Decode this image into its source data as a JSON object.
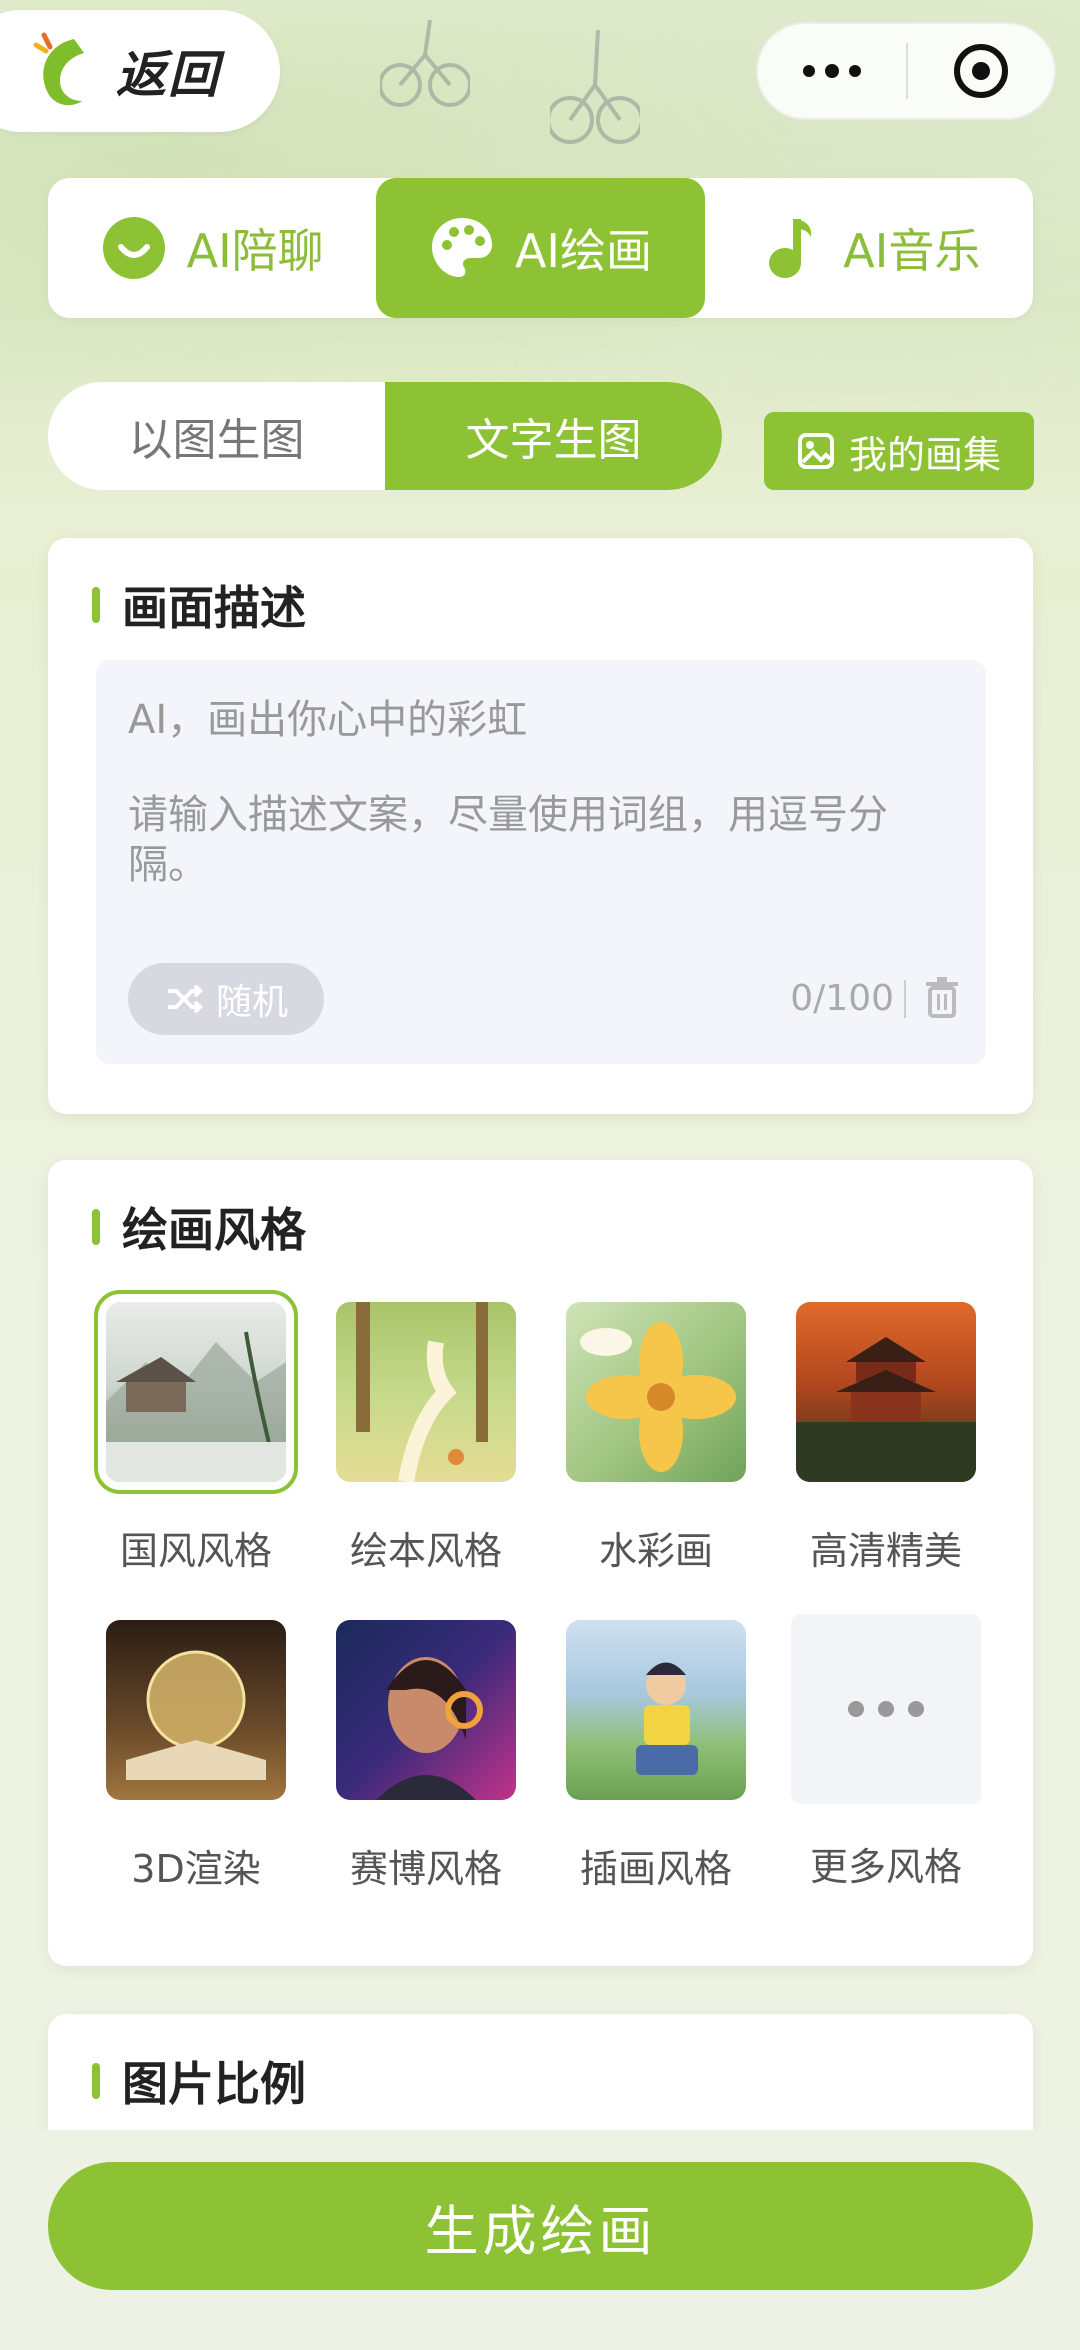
{
  "header": {
    "back_label": "返回"
  },
  "main_tabs": [
    {
      "label": "AI陪聊",
      "icon": "chat-smile-icon",
      "active": false
    },
    {
      "label": "AI绘画",
      "icon": "palette-icon",
      "active": true
    },
    {
      "label": "AI音乐",
      "icon": "music-note-icon",
      "active": false
    }
  ],
  "sub_tabs": [
    {
      "label": "以图生图",
      "active": false
    },
    {
      "label": "文字生图",
      "active": true
    }
  ],
  "gallery_button": {
    "label": "我的画集",
    "icon": "image-icon"
  },
  "description": {
    "title": "画面描述",
    "placeholder_line1": "AI，画出你心中的彩虹",
    "placeholder_line2": "请输入描述文案，尽量使用词组，用逗号分隔。",
    "random_label": "随机",
    "counter": "0/100"
  },
  "styles": {
    "title": "绘画风格",
    "items": [
      {
        "label": "国风风格",
        "selected": true
      },
      {
        "label": "绘本风格",
        "selected": false
      },
      {
        "label": "水彩画",
        "selected": false
      },
      {
        "label": "高清精美",
        "selected": false
      },
      {
        "label": "3D渲染",
        "selected": false
      },
      {
        "label": "赛博风格",
        "selected": false
      },
      {
        "label": "插画风格",
        "selected": false
      },
      {
        "label": "更多风格",
        "selected": false
      }
    ]
  },
  "ratio": {
    "title": "图片比例"
  },
  "generate_button": {
    "label": "生成绘画"
  },
  "colors": {
    "accent": "#8cc234",
    "background": "#eef2e4",
    "input_bg": "#f4f5fa"
  }
}
